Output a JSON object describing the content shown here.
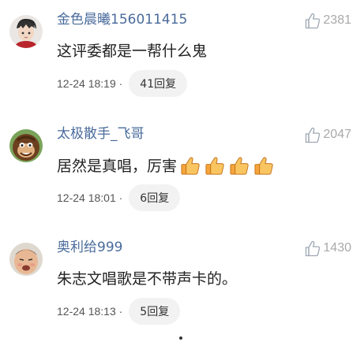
{
  "comments": [
    {
      "username": "金色晨曦156011415",
      "likes": "2381",
      "text": "这评委都是一帮什么鬼",
      "time": "12-24 18:19 ·",
      "replies": "41回复"
    },
    {
      "username": "太极散手_飞哥",
      "likes": "2047",
      "text": "居然是真唱，厉害",
      "time": "12-24 18:01 ·",
      "replies": "6回复",
      "emoji_count": 4
    },
    {
      "username": "奥利给999",
      "likes": "1430",
      "text": "朱志文唱歌是不带声卡的。",
      "time": "12-24 18:13 ·",
      "replies": "5回复"
    }
  ]
}
